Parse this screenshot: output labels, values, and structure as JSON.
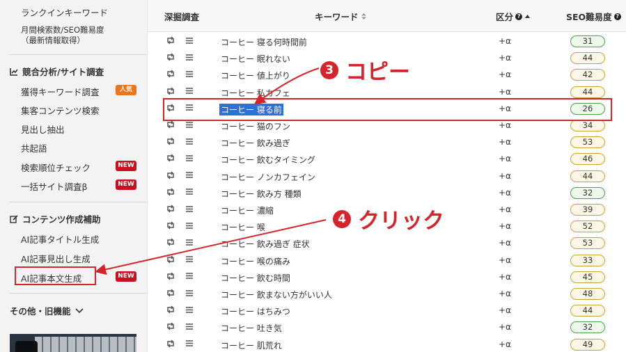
{
  "sidebar": {
    "ranking_keywords": "ランクインキーワード",
    "monthly_seo_line1": "月間検索数/SEO難易度",
    "monthly_seo_line2": "（最新情報取得）",
    "section_competitive": "競合分析/サイト調査",
    "acquired_keywords": "獲得キーワード調査",
    "acquired_badge": "人気",
    "traffic_content": "集客コンテンツ検索",
    "heading_extract": "見出し抽出",
    "cooccurrence": "共起語",
    "rank_check": "検索順位チェック",
    "rank_check_badge": "NEW",
    "bulk_site": "一括サイト調査β",
    "bulk_site_badge": "NEW",
    "section_content": "コンテンツ作成補助",
    "ai_title": "AI記事タイトル生成",
    "ai_heading": "AI記事見出し生成",
    "ai_body": "AI記事本文生成",
    "ai_body_badge": "NEW",
    "section_other": "その他・旧機能"
  },
  "table": {
    "col_deep": "深掘調査",
    "col_keyword": "キーワード",
    "col_kubun": "区分",
    "col_seo": "SEO難易度",
    "rows": [
      {
        "keyword": "コーヒー 寝る何時間前",
        "kubun": "+α",
        "seo": "31",
        "level": "green"
      },
      {
        "keyword": "コーヒー 眠れない",
        "kubun": "+α",
        "seo": "44",
        "level": "yellow"
      },
      {
        "keyword": "コーヒー 値上がり",
        "kubun": "+α",
        "seo": "42",
        "level": "yellow"
      },
      {
        "keyword": "コーヒー 私カフェ",
        "kubun": "+α",
        "seo": "44",
        "level": "yellow"
      },
      {
        "keyword": "コーヒー 寝る前",
        "kubun": "+α",
        "seo": "26",
        "level": "green",
        "selected": true
      },
      {
        "keyword": "コーヒー 猫のフン",
        "kubun": "+α",
        "seo": "34",
        "level": "yellow"
      },
      {
        "keyword": "コーヒー 飲み過ぎ",
        "kubun": "+α",
        "seo": "53",
        "level": "yellow"
      },
      {
        "keyword": "コーヒー 飲むタイミング",
        "kubun": "+α",
        "seo": "46",
        "level": "yellow"
      },
      {
        "keyword": "コーヒー ノンカフェイン",
        "kubun": "+α",
        "seo": "44",
        "level": "yellow"
      },
      {
        "keyword": "コーヒー 飲み方 種類",
        "kubun": "+α",
        "seo": "32",
        "level": "green"
      },
      {
        "keyword": "コーヒー 濃縮",
        "kubun": "+α",
        "seo": "39",
        "level": "yellow"
      },
      {
        "keyword": "コーヒー 喉",
        "kubun": "+α",
        "seo": "52",
        "level": "yellow"
      },
      {
        "keyword": "コーヒー 飲み過ぎ 症状",
        "kubun": "+α",
        "seo": "53",
        "level": "yellow"
      },
      {
        "keyword": "コーヒー 喉の痛み",
        "kubun": "+α",
        "seo": "33",
        "level": "yellow"
      },
      {
        "keyword": "コーヒー 飲む時間",
        "kubun": "+α",
        "seo": "45",
        "level": "yellow"
      },
      {
        "keyword": "コーヒー 飲まない方がいい人",
        "kubun": "+α",
        "seo": "48",
        "level": "yellow"
      },
      {
        "keyword": "コーヒー はちみつ",
        "kubun": "+α",
        "seo": "44",
        "level": "yellow"
      },
      {
        "keyword": "コーヒー 吐き気",
        "kubun": "+α",
        "seo": "32",
        "level": "green"
      },
      {
        "keyword": "コーヒー 肌荒れ",
        "kubun": "+α",
        "seo": "49",
        "level": "yellow"
      }
    ]
  },
  "annotations": {
    "step3_num": "3",
    "step3_text": "コピー",
    "step4_num": "4",
    "step4_text": "クリック"
  },
  "colors": {
    "accent_red": "#d6242c",
    "selection_blue": "#2f6fd6",
    "seo_green": "#4ea04e",
    "seo_yellow": "#c9a23a"
  }
}
